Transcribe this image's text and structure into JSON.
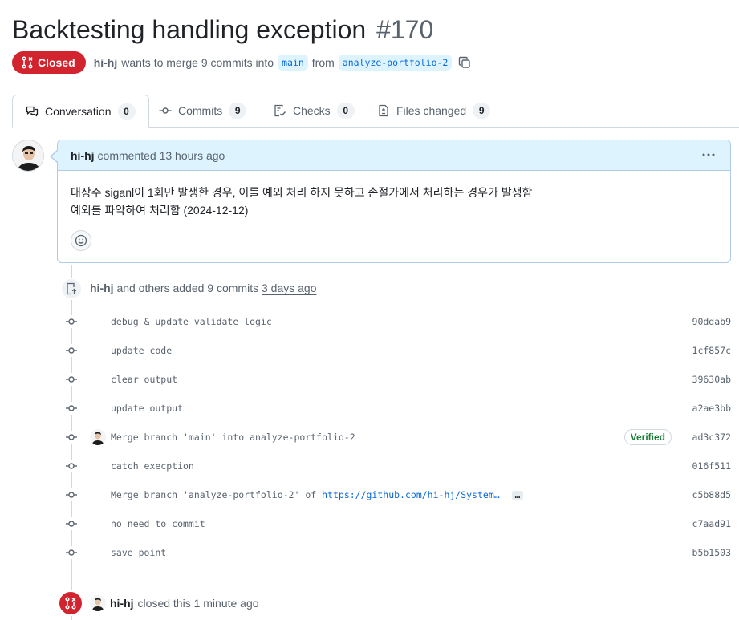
{
  "pr": {
    "title": "Backtesting handling exception",
    "number": "#170",
    "state_label": "Closed",
    "author": "hi-hj",
    "merge_text_1": "wants to merge 9 commits into",
    "base_branch": "main",
    "merge_text_2": "from",
    "head_branch": "analyze-portfolio-2"
  },
  "tabs": [
    {
      "label": "Conversation",
      "count": "0"
    },
    {
      "label": "Commits",
      "count": "9"
    },
    {
      "label": "Checks",
      "count": "0"
    },
    {
      "label": "Files changed",
      "count": "9"
    }
  ],
  "comment": {
    "author": "hi-hj",
    "meta": "commented 13 hours ago",
    "body_line_1": "대장주 siganl이 1회만 발생한 경우, 이를 예외 처리 하지 못하고 손절가에서 처리하는 경우가 발생함",
    "body_line_2": "예외를 파악하여 처리함 (2024-12-12)"
  },
  "push_event": {
    "author": "hi-hj",
    "text": "and others added 9 commits",
    "time": "3 days ago"
  },
  "commits": [
    {
      "message": "debug & update validate logic",
      "sha": "90ddab9"
    },
    {
      "message": "update code",
      "sha": "1cf857c"
    },
    {
      "message": "clear output",
      "sha": "39630ab"
    },
    {
      "message": "update output",
      "sha": "a2ae3bb"
    },
    {
      "message": "Merge branch 'main' into analyze-portfolio-2",
      "sha": "ad3c372",
      "verified": "Verified"
    },
    {
      "message": "catch execption",
      "sha": "016f511"
    },
    {
      "message": "Merge branch 'analyze-portfolio-2' of",
      "link": "https://github.com/hi-hj/System…",
      "sha": "c5b88d5",
      "more": "…"
    },
    {
      "message": "no need to commit",
      "sha": "c7aad91"
    },
    {
      "message": "save point",
      "sha": "b5b1503"
    }
  ],
  "closed_event": {
    "author": "hi-hj",
    "text": "closed this 1 minute ago"
  },
  "colors": {
    "closed_red": "#d1242f",
    "link_blue": "#0969da",
    "comment_header_bg": "#ddf4ff",
    "verified_green": "#1a7f37"
  }
}
